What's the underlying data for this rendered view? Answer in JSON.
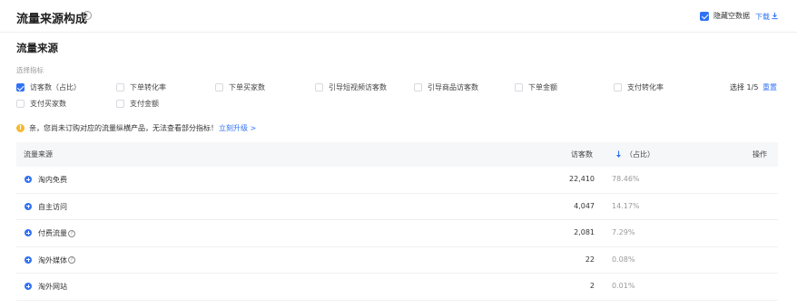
{
  "header": {
    "title": "流量来源构成",
    "info_glyph": "i",
    "hide_empty_label": "隐藏空数据",
    "hide_empty_checked": true,
    "download_label": "下载",
    "download_icon": "download-icon"
  },
  "section": {
    "title": "流量来源",
    "metric_caption": "选择指标"
  },
  "metrics": [
    {
      "label": "访客数（占比）",
      "checked": true
    },
    {
      "label": "下单转化率",
      "checked": false
    },
    {
      "label": "下单买家数",
      "checked": false
    },
    {
      "label": "引导短视频访客数",
      "checked": false
    },
    {
      "label": "引导商品访客数",
      "checked": false
    },
    {
      "label": "下单金额",
      "checked": false
    },
    {
      "label": "支付转化率",
      "checked": false
    },
    {
      "label": "支付买家数",
      "checked": false
    },
    {
      "label": "支付金额",
      "checked": false
    }
  ],
  "selection": {
    "count_text": "选择 1/5",
    "reset_label": "重置"
  },
  "notice": {
    "icon": "warning-icon",
    "icon_glyph": "!",
    "text": "亲，您尚未订购对应的流量纵横产品，无法查看部分指标！",
    "link_label": "立刻升级 >"
  },
  "table": {
    "columns": {
      "source": "流量来源",
      "visitors": "访客数",
      "share": "（占比）",
      "actions": "操作"
    },
    "sort_icon": "sort-desc-icon",
    "rows": [
      {
        "name": "淘内免费",
        "has_help": false,
        "visitors": "22,410",
        "share": "78.46%"
      },
      {
        "name": "自主访问",
        "has_help": false,
        "visitors": "4,047",
        "share": "14.17%"
      },
      {
        "name": "付费流量",
        "has_help": true,
        "visitors": "2,081",
        "share": "7.29%"
      },
      {
        "name": "淘外媒体",
        "has_help": true,
        "visitors": "22",
        "share": "0.08%"
      },
      {
        "name": "淘外网站",
        "has_help": false,
        "visitors": "2",
        "share": "0.01%"
      }
    ],
    "help_glyph": "?"
  },
  "colors": {
    "accent": "#3072f6",
    "warning": "#f5b82e",
    "muted_text": "#999999"
  }
}
